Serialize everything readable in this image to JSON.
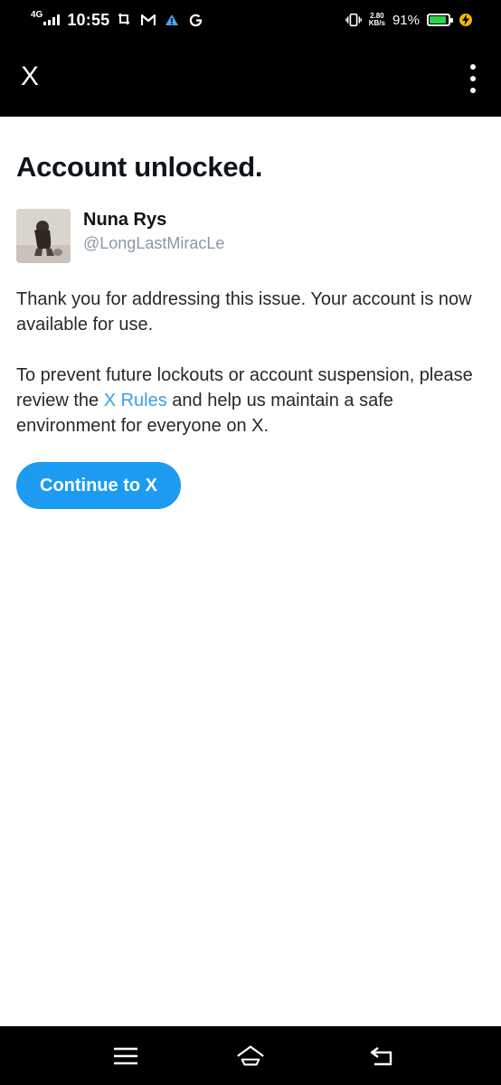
{
  "status_bar": {
    "network": "4G",
    "time": "10:55",
    "speed_value": "2.80",
    "speed_unit": "KB/s",
    "battery_percent": "91%",
    "battery_level": 0.91,
    "battery_color": "#2ed14a",
    "notification_icons": [
      "screenshot-icon",
      "gmail-icon",
      "alert-triangle-icon",
      "google-icon"
    ],
    "right_icons": [
      "vibrate-icon",
      "battery-icon",
      "charging-icon"
    ]
  },
  "app_bar": {
    "close_label": "X",
    "menu_icon": "more-vertical-icon"
  },
  "main": {
    "title": "Account unlocked.",
    "user": {
      "name": "Nuna Rys",
      "handle": "@LongLastMiracLe"
    },
    "paragraph1": "Thank you for addressing this issue. Your account is now available for use.",
    "paragraph2_before": "To prevent future lockouts or account suspension, please review the ",
    "paragraph2_link": "X Rules",
    "paragraph2_after": " and help us maintain a safe environment for everyone on X.",
    "link_color": "#3b9ee8",
    "continue_button": "Continue to X",
    "accent_color": "#1d9bf0"
  },
  "nav_bar": {
    "icons": [
      "menu-icon",
      "home-icon",
      "back-icon"
    ]
  }
}
